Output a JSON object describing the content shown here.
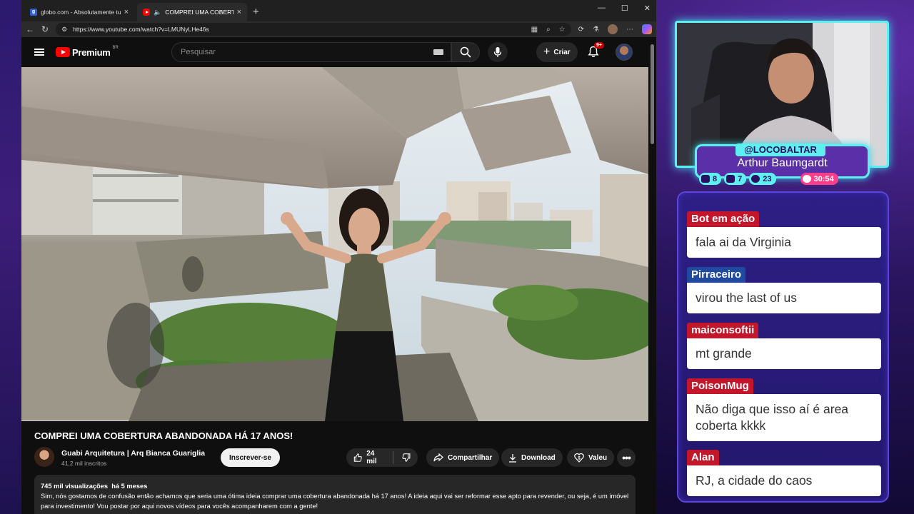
{
  "browser": {
    "tabs": [
      {
        "title": "globo.com - Absolutamente tudo",
        "active": false
      },
      {
        "title": "COMPREI UMA COBERTURA",
        "active": true
      }
    ],
    "url": "https://www.youtube.com/watch?v=LMUNyLHe46s"
  },
  "youtube": {
    "logo_text": "Premium",
    "region": "BR",
    "search_placeholder": "Pesquisar",
    "create_label": "Criar",
    "notifications_badge": "9+",
    "video": {
      "title": "COMPREI UMA COBERTURA ABANDONADA HÁ 17 ANOS!",
      "channel_name": "Guabi Arquitetura | Arq Bianca Guariglia",
      "subscribers": "41,2 mil inscritos",
      "subscribe_label": "Inscrever-se",
      "likes": "24 mil",
      "share_label": "Compartilhar",
      "download_label": "Download",
      "thanks_label": "Valeu",
      "views": "745 mil visualizações",
      "age": "há 5 meses",
      "description": "Sim, nós gostamos de confusão então achamos que seria uma ótima ideia comprar uma cobertura abandonada há 17 anos! A ideia aqui vai ser reformar esse apto para revender, ou seja, é um imóvel para investimento! Vou postar por aqui novos vídeos para vocês acompanharem com a gente!"
    }
  },
  "overlay": {
    "handle": "@LOCOBALTAR",
    "name": "Arthur Baumgardt",
    "stats": {
      "twitch": "8",
      "youtube": "7",
      "kick": "23",
      "timer": "30:54"
    },
    "chat": [
      {
        "user": "Bot em ação",
        "text": "fala ai da Virginia",
        "color": "#c4162a"
      },
      {
        "user": "Pirraceiro",
        "text": "virou the last of us",
        "color": "#1f4aa0"
      },
      {
        "user": "maiconsoftii",
        "text": "mt grande",
        "color": "#c4162a"
      },
      {
        "user": "PoisonMug",
        "text": "Não diga que isso aí é area coberta kkkk",
        "color": "#c4162a"
      },
      {
        "user": "Alan",
        "text": "RJ, a cidade do caos",
        "color": "#c4162a"
      }
    ]
  }
}
